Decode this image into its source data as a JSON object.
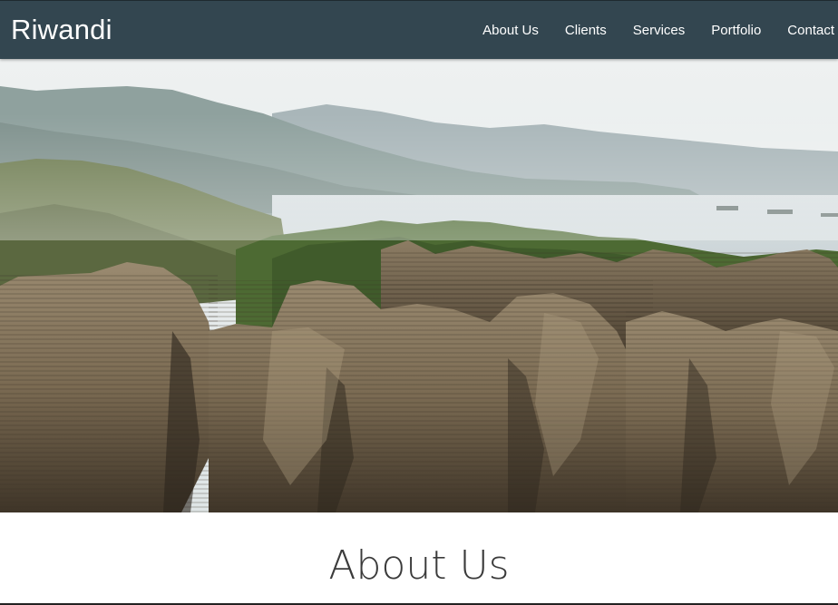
{
  "navbar": {
    "brand": "Riwandi",
    "links": [
      {
        "label": "About Us"
      },
      {
        "label": "Clients"
      },
      {
        "label": "Services"
      },
      {
        "label": "Portfolio"
      },
      {
        "label": "Contact"
      }
    ],
    "background_color": "#334650"
  },
  "hero": {
    "image": "coastal-rock-pancake-stacks-photo"
  },
  "about": {
    "title": "About Us"
  }
}
